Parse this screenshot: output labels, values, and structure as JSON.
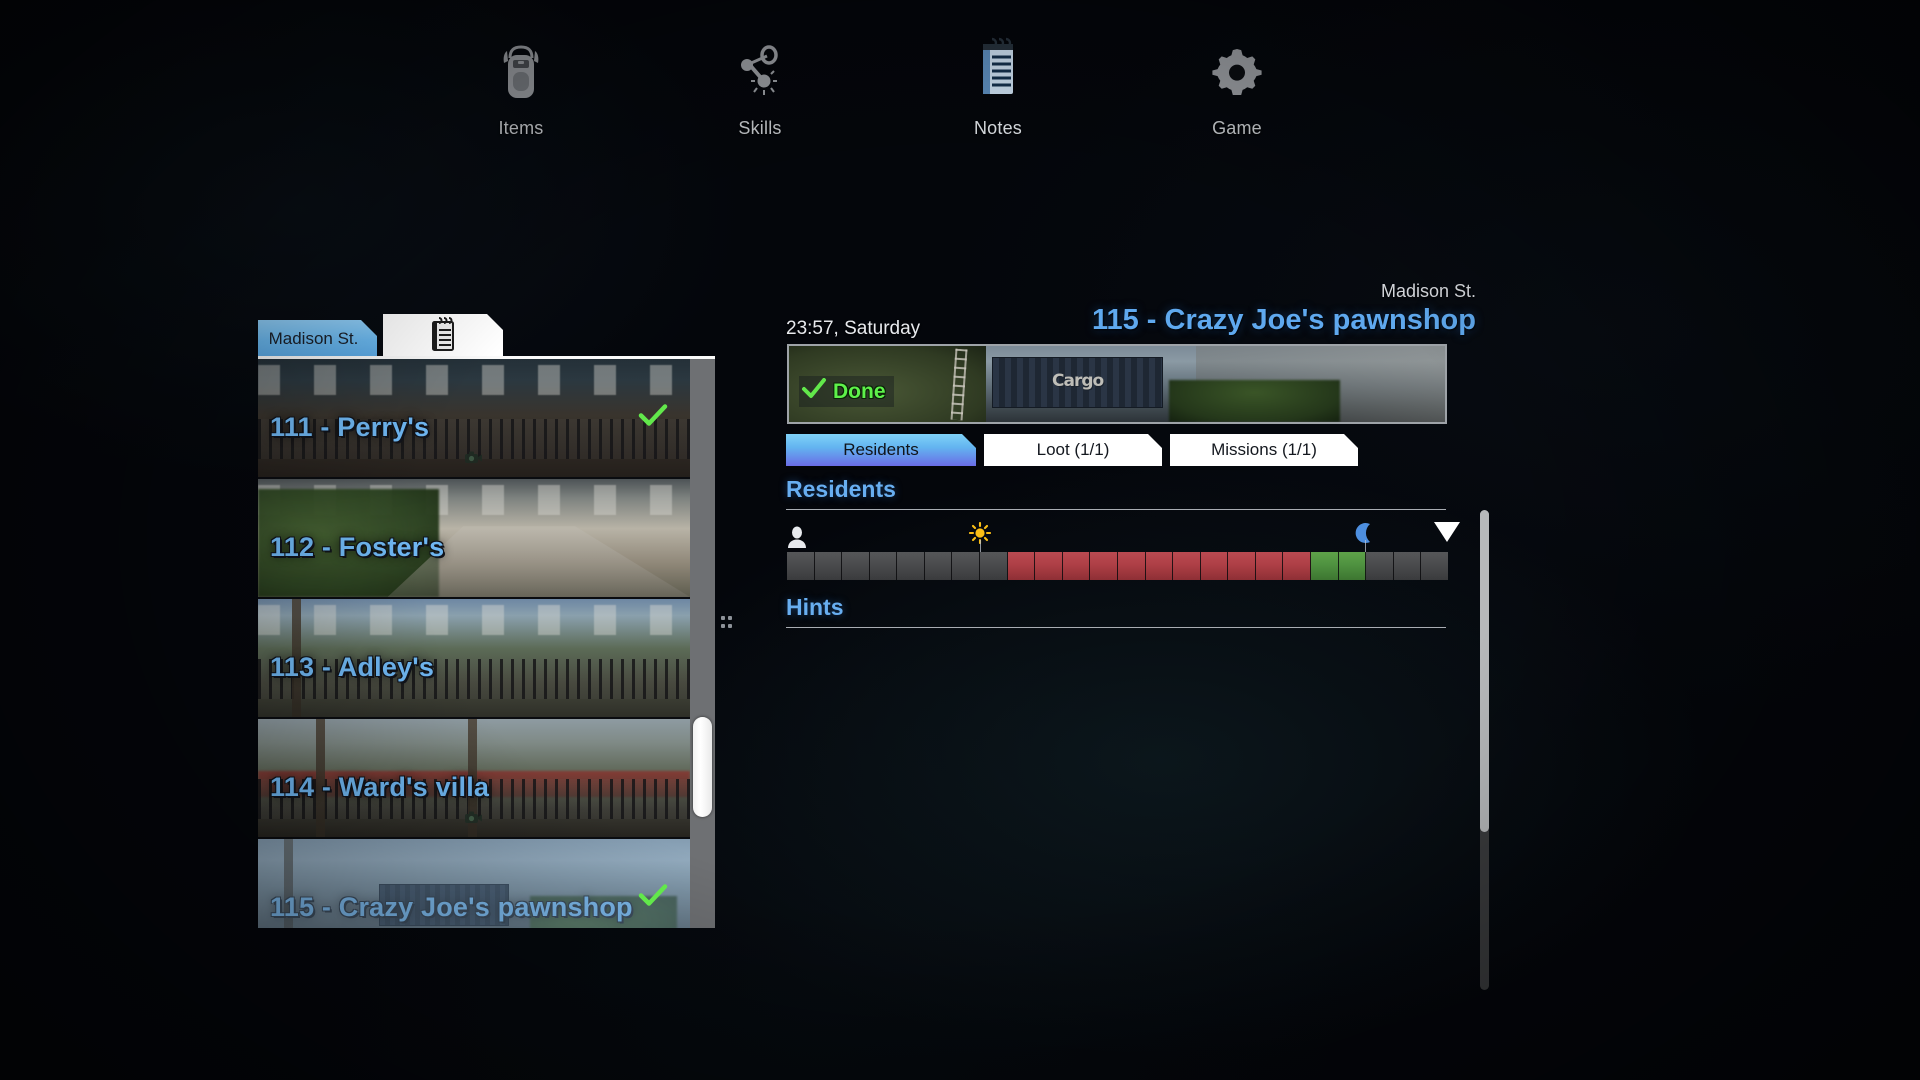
{
  "top_menu": {
    "items": [
      {
        "label": "Items",
        "icon": "backpack-icon",
        "active": false
      },
      {
        "label": "Skills",
        "icon": "skill-tree-icon",
        "active": false
      },
      {
        "label": "Notes",
        "icon": "notepad-icon",
        "active": true
      },
      {
        "label": "Game",
        "icon": "gear-icon",
        "active": false
      }
    ]
  },
  "left_panel": {
    "tabs": [
      {
        "label": "Madison St.",
        "name": "street-tab",
        "active": true
      },
      {
        "label": "",
        "name": "notes-tab",
        "icon": "notepad-icon",
        "active": false
      }
    ],
    "rows": [
      {
        "title": "111 - Perry's",
        "done": true,
        "camera": true,
        "selected": false
      },
      {
        "title": "112 - Foster's",
        "done": false,
        "camera": false,
        "selected": false
      },
      {
        "title": "113 - Adley's",
        "done": false,
        "camera": false,
        "selected": false
      },
      {
        "title": "114 - Ward's villa",
        "done": false,
        "camera": true,
        "selected": false
      },
      {
        "title": "115 - Crazy Joe's pawnshop",
        "done": true,
        "camera": false,
        "selected": true
      }
    ]
  },
  "right_panel": {
    "clock": "23:57, Saturday",
    "street": "Madison St.",
    "title": "115 - Crazy Joe's pawnshop",
    "hero": {
      "status_label": "Done",
      "status_icon": "check-icon",
      "sign_text": "Cargo"
    },
    "tabs": [
      {
        "label": "Residents",
        "active": true
      },
      {
        "label": "Loot (1/1)",
        "active": false
      },
      {
        "label": "Missions (1/1)",
        "active": false
      }
    ],
    "residents": {
      "heading": "Residents",
      "person_icon": "person-icon",
      "sunrise_icon": "sun-icon",
      "sunset_icon": "moon-icon",
      "current_time_icon": "triangle-down-marker",
      "sunrise_hour": 7,
      "sunset_hour": 21,
      "current_hour": 23.95,
      "hours": 24,
      "segments": [
        "gray",
        "gray",
        "gray",
        "gray",
        "gray",
        "gray",
        "gray",
        "gray",
        "red",
        "red",
        "red",
        "red",
        "red",
        "red",
        "red",
        "red",
        "red",
        "red",
        "red",
        "green",
        "green",
        "gray",
        "gray",
        "gray"
      ]
    },
    "hints": {
      "heading": "Hints",
      "entries": []
    }
  },
  "colors": {
    "accent_blue": "#5fa9ef",
    "tab_active_from": "#7fd2f8",
    "tab_active_to": "#6a6ce6",
    "done_green": "#5ef14a",
    "segment_red": "#ae3f46",
    "segment_green": "#4f9240",
    "segment_gray": "#4a4b4d",
    "panel_bg": "#04060b"
  }
}
